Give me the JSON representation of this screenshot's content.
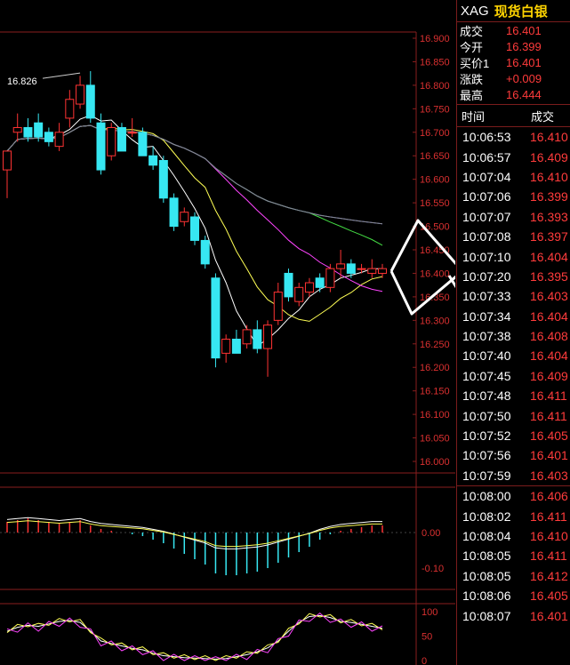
{
  "quote": {
    "symbol": "XAG",
    "name": "现货白银",
    "rows": [
      {
        "label": "成交",
        "value": "16.401"
      },
      {
        "label": "今开",
        "value": "16.399"
      },
      {
        "label": "买价1",
        "value": "16.401"
      },
      {
        "label": "涨跌",
        "value": "+0.009"
      },
      {
        "label": "最高",
        "value": "16.444"
      }
    ]
  },
  "ticks": {
    "header_time": "时间",
    "header_price": "成交",
    "rows": [
      {
        "time": "10:06:53",
        "price": "16.410"
      },
      {
        "time": "10:06:57",
        "price": "16.409"
      },
      {
        "time": "10:07:04",
        "price": "16.410"
      },
      {
        "time": "10:07:06",
        "price": "16.399"
      },
      {
        "time": "10:07:07",
        "price": "16.393"
      },
      {
        "time": "10:07:08",
        "price": "16.397"
      },
      {
        "time": "10:07:10",
        "price": "16.404"
      },
      {
        "time": "10:07:20",
        "price": "16.395"
      },
      {
        "time": "10:07:33",
        "price": "16.403"
      },
      {
        "time": "10:07:34",
        "price": "16.404"
      },
      {
        "time": "10:07:38",
        "price": "16.408"
      },
      {
        "time": "10:07:40",
        "price": "16.404"
      },
      {
        "time": "10:07:45",
        "price": "16.409"
      },
      {
        "time": "10:07:48",
        "price": "16.411"
      },
      {
        "time": "10:07:50",
        "price": "16.411"
      },
      {
        "time": "10:07:52",
        "price": "16.405"
      },
      {
        "time": "10:07:56",
        "price": "16.401"
      },
      {
        "time": "10:07:59",
        "price": "16.403"
      },
      {
        "time": "10:08:00",
        "price": "16.406"
      },
      {
        "time": "10:08:02",
        "price": "16.411"
      },
      {
        "time": "10:08:04",
        "price": "16.410"
      },
      {
        "time": "10:08:05",
        "price": "16.411"
      },
      {
        "time": "10:08:05",
        "price": "16.412"
      },
      {
        "time": "10:08:06",
        "price": "16.405"
      },
      {
        "time": "10:08:07",
        "price": "16.401"
      }
    ]
  },
  "chart_data": [
    {
      "type": "candlestick",
      "annotation": "16.826",
      "yticks": [
        "16.900",
        "16.850",
        "16.800",
        "16.750",
        "16.700",
        "16.650",
        "16.600",
        "16.550",
        "16.500",
        "16.450",
        "16.400",
        "16.350",
        "16.300",
        "16.250",
        "16.200",
        "16.150",
        "16.100",
        "16.050",
        "16.000"
      ],
      "ylim": [
        16.0,
        16.9
      ],
      "candles": [
        {
          "o": 16.62,
          "h": 16.66,
          "l": 16.56,
          "c": 16.66
        },
        {
          "o": 16.7,
          "h": 16.74,
          "l": 16.68,
          "c": 16.71
        },
        {
          "o": 16.71,
          "h": 16.73,
          "l": 16.68,
          "c": 16.69
        },
        {
          "o": 16.72,
          "h": 16.74,
          "l": 16.68,
          "c": 16.69
        },
        {
          "o": 16.7,
          "h": 16.71,
          "l": 16.67,
          "c": 16.68
        },
        {
          "o": 16.67,
          "h": 16.72,
          "l": 16.66,
          "c": 16.7
        },
        {
          "o": 16.73,
          "h": 16.79,
          "l": 16.71,
          "c": 16.77
        },
        {
          "o": 16.76,
          "h": 16.82,
          "l": 16.75,
          "c": 16.8
        },
        {
          "o": 16.8,
          "h": 16.83,
          "l": 16.72,
          "c": 16.73
        },
        {
          "o": 16.72,
          "h": 16.74,
          "l": 16.61,
          "c": 16.62
        },
        {
          "o": 16.65,
          "h": 16.72,
          "l": 16.64,
          "c": 16.71
        },
        {
          "o": 16.71,
          "h": 16.72,
          "l": 16.66,
          "c": 16.66
        },
        {
          "o": 16.7,
          "h": 16.73,
          "l": 16.69,
          "c": 16.7
        },
        {
          "o": 16.7,
          "h": 16.71,
          "l": 16.65,
          "c": 16.65
        },
        {
          "o": 16.65,
          "h": 16.67,
          "l": 16.62,
          "c": 16.63
        },
        {
          "o": 16.64,
          "h": 16.65,
          "l": 16.55,
          "c": 16.56
        },
        {
          "o": 16.56,
          "h": 16.57,
          "l": 16.49,
          "c": 16.5
        },
        {
          "o": 16.51,
          "h": 16.54,
          "l": 16.5,
          "c": 16.53
        },
        {
          "o": 16.52,
          "h": 16.53,
          "l": 16.46,
          "c": 16.47
        },
        {
          "o": 16.47,
          "h": 16.48,
          "l": 16.41,
          "c": 16.42
        },
        {
          "o": 16.39,
          "h": 16.4,
          "l": 16.2,
          "c": 16.22
        },
        {
          "o": 16.23,
          "h": 16.27,
          "l": 16.21,
          "c": 16.26
        },
        {
          "o": 16.26,
          "h": 16.28,
          "l": 16.23,
          "c": 16.23
        },
        {
          "o": 16.25,
          "h": 16.29,
          "l": 16.24,
          "c": 16.28
        },
        {
          "o": 16.28,
          "h": 16.3,
          "l": 16.23,
          "c": 16.24
        },
        {
          "o": 16.24,
          "h": 16.3,
          "l": 16.18,
          "c": 16.29
        },
        {
          "o": 16.3,
          "h": 16.38,
          "l": 16.29,
          "c": 16.36
        },
        {
          "o": 16.4,
          "h": 16.41,
          "l": 16.34,
          "c": 16.35
        },
        {
          "o": 16.34,
          "h": 16.38,
          "l": 16.33,
          "c": 16.37
        },
        {
          "o": 16.36,
          "h": 16.39,
          "l": 16.35,
          "c": 16.38
        },
        {
          "o": 16.39,
          "h": 16.4,
          "l": 16.36,
          "c": 16.37
        },
        {
          "o": 16.37,
          "h": 16.42,
          "l": 16.36,
          "c": 16.41
        },
        {
          "o": 16.41,
          "h": 16.45,
          "l": 16.39,
          "c": 16.42
        },
        {
          "o": 16.42,
          "h": 16.43,
          "l": 16.39,
          "c": 16.4
        },
        {
          "o": 16.41,
          "h": 16.42,
          "l": 16.4,
          "c": 16.41
        },
        {
          "o": 16.4,
          "h": 16.43,
          "l": 16.39,
          "c": 16.41
        },
        {
          "o": 16.4,
          "h": 16.42,
          "l": 16.39,
          "c": 16.41
        }
      ]
    },
    {
      "type": "bar",
      "yticks": [
        "0.00",
        "-0.10"
      ],
      "ylim": [
        -0.12,
        0.1
      ],
      "values": [
        0.03,
        0.035,
        0.04,
        0.035,
        0.03,
        0.025,
        0.03,
        0.035,
        0.02,
        0.01,
        0.005,
        0.0,
        -0.005,
        -0.01,
        -0.02,
        -0.03,
        -0.045,
        -0.06,
        -0.075,
        -0.09,
        -0.115,
        -0.12,
        -0.12,
        -0.115,
        -0.11,
        -0.1,
        -0.085,
        -0.07,
        -0.055,
        -0.04,
        -0.02,
        -0.005,
        0.005,
        0.01,
        0.015,
        0.02,
        0.02
      ]
    },
    {
      "type": "line",
      "yticks": [
        "100",
        "50",
        "0"
      ],
      "ylim": [
        0,
        100
      ]
    }
  ]
}
